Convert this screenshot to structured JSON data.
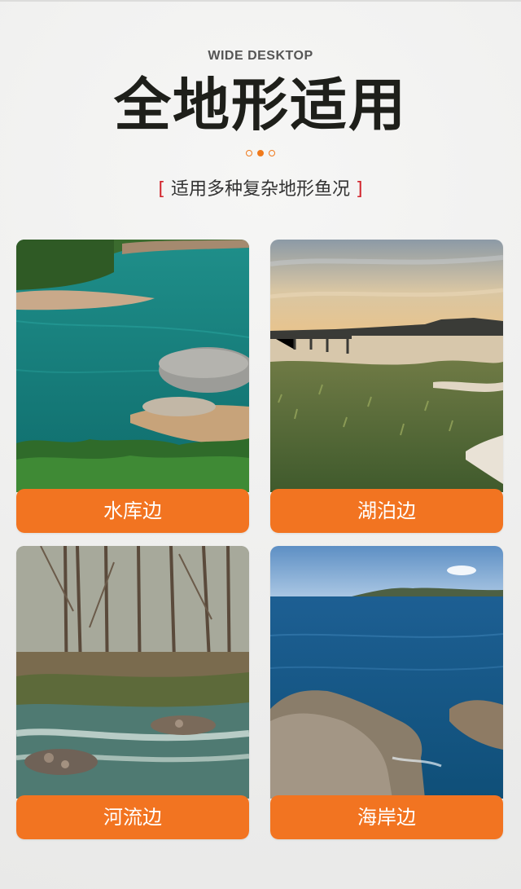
{
  "header": {
    "subtitle_en": "WIDE DESKTOP",
    "title": "全地形适用",
    "tagline_open": "[",
    "tagline": "适用多种复杂地形鱼况",
    "tagline_close": "]"
  },
  "colors": {
    "accent": "#f27421",
    "bracket": "#d2222a",
    "title": "#1e1f1a"
  },
  "cards": [
    {
      "label": "水库边",
      "icon": "reservoir-photo"
    },
    {
      "label": "湖泊边",
      "icon": "lake-photo"
    },
    {
      "label": "河流边",
      "icon": "river-photo"
    },
    {
      "label": "海岸边",
      "icon": "coast-photo"
    }
  ]
}
